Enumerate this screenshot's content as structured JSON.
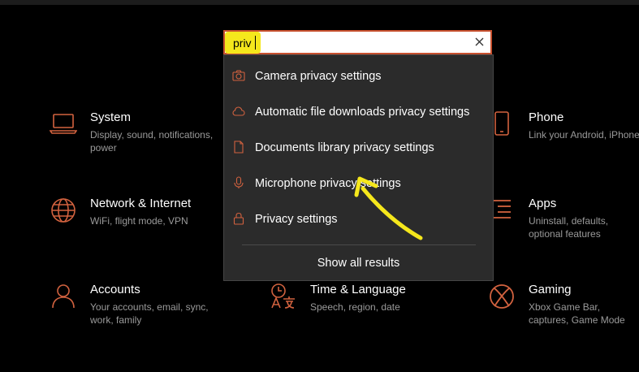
{
  "colors": {
    "accent": "#d2623f",
    "background": "#000000",
    "dropdown": "#2b2b2b",
    "highlight": "#f5e71c"
  },
  "search": {
    "value": "priv",
    "clear_icon": "close-icon"
  },
  "results": [
    {
      "icon": "camera-icon",
      "label": "Camera privacy settings"
    },
    {
      "icon": "cloud-icon",
      "label": "Automatic file downloads privacy settings"
    },
    {
      "icon": "document-icon",
      "label": "Documents library privacy settings"
    },
    {
      "icon": "microphone-icon",
      "label": "Microphone privacy settings"
    },
    {
      "icon": "lock-icon",
      "label": "Privacy settings"
    }
  ],
  "show_all_label": "Show all results",
  "tiles": {
    "system": {
      "icon": "laptop-icon",
      "title": "System",
      "desc": "Display, sound, notifications, power"
    },
    "phone": {
      "icon": "phone-icon",
      "title": "Phone",
      "desc": "Link your Android, iPhone"
    },
    "network": {
      "icon": "globe-icon",
      "title": "Network & Internet",
      "desc": "WiFi, flight mode, VPN"
    },
    "apps": {
      "icon": "apps-list-icon",
      "title": "Apps",
      "desc": "Uninstall, defaults, optional features"
    },
    "accounts": {
      "icon": "person-icon",
      "title": "Accounts",
      "desc": "Your accounts, email, sync, work, family"
    },
    "time": {
      "icon": "time-language-icon",
      "title": "Time & Language",
      "desc": "Speech, region, date"
    },
    "gaming": {
      "icon": "xbox-icon",
      "title": "Gaming",
      "desc": "Xbox Game Bar, captures, Game Mode"
    }
  }
}
